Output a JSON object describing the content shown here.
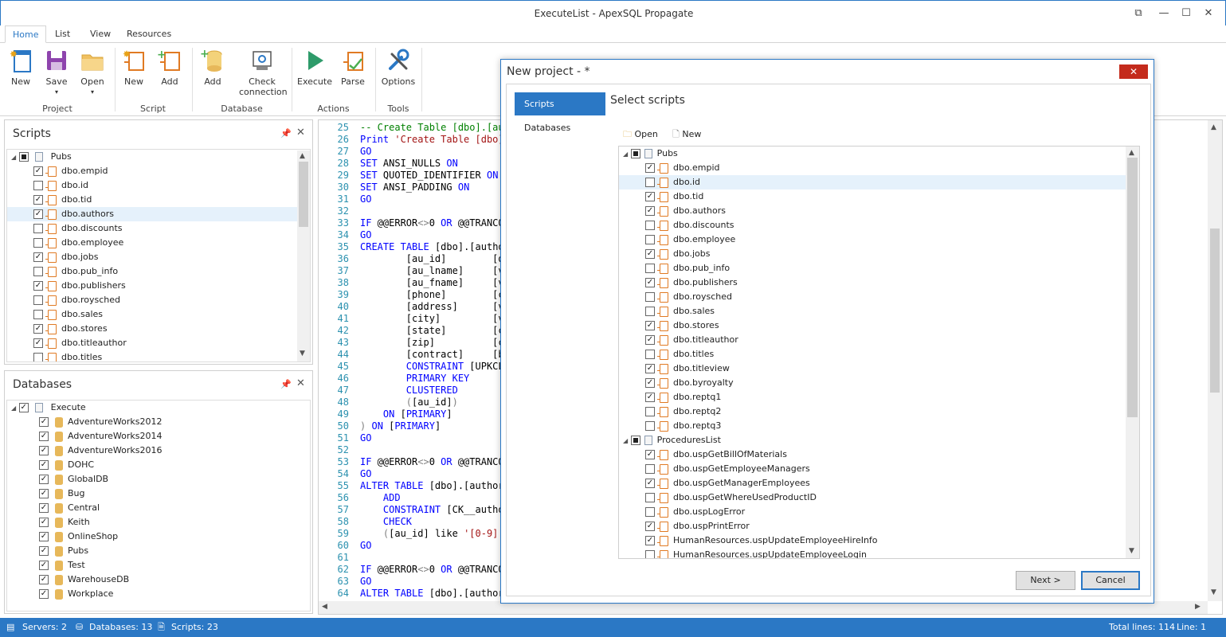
{
  "window": {
    "title": "ExecuteList - ApexSQL Propagate"
  },
  "ribbon_tabs": [
    "Home",
    "List",
    "View",
    "Resources"
  ],
  "ribbon": {
    "buttons": [
      {
        "label": "New",
        "icon": "new-project-icon"
      },
      {
        "label": "Save",
        "icon": "save-icon",
        "dropdown": true
      },
      {
        "label": "Open",
        "icon": "open-folder-icon",
        "dropdown": true
      },
      {
        "label": "New",
        "icon": "new-script-icon"
      },
      {
        "label": "Add",
        "icon": "add-script-icon"
      },
      {
        "label": "Add",
        "icon": "add-database-icon"
      },
      {
        "label": "Check connection",
        "icon": "check-connection-icon"
      },
      {
        "label": "Execute",
        "icon": "execute-icon"
      },
      {
        "label": "Parse",
        "icon": "parse-icon"
      },
      {
        "label": "Options",
        "icon": "options-icon"
      }
    ],
    "groups": [
      "Project",
      "Script",
      "Database",
      "Actions",
      "Tools"
    ]
  },
  "scripts_panel": {
    "title": "Scripts",
    "root": "Pubs",
    "items": [
      {
        "name": "dbo.empid",
        "checked": true
      },
      {
        "name": "dbo.id",
        "checked": false
      },
      {
        "name": "dbo.tid",
        "checked": true
      },
      {
        "name": "dbo.authors",
        "checked": true
      },
      {
        "name": "dbo.discounts",
        "checked": false
      },
      {
        "name": "dbo.employee",
        "checked": false
      },
      {
        "name": "dbo.jobs",
        "checked": true
      },
      {
        "name": "dbo.pub_info",
        "checked": false
      },
      {
        "name": "dbo.publishers",
        "checked": true
      },
      {
        "name": "dbo.roysched",
        "checked": false
      },
      {
        "name": "dbo.sales",
        "checked": false
      },
      {
        "name": "dbo.stores",
        "checked": true
      },
      {
        "name": "dbo.titleauthor",
        "checked": true
      },
      {
        "name": "dbo.titles",
        "checked": false
      }
    ]
  },
  "databases_panel": {
    "title": "Databases",
    "root": "Execute",
    "items": [
      "AdventureWorks2012",
      "AdventureWorks2014",
      "AdventureWorks2016",
      "DOHC",
      "GlobalDB",
      "Bug",
      "Central",
      "Keith",
      "OnlineShop",
      "Pubs",
      "Test",
      "WarehouseDB",
      "Workplace"
    ]
  },
  "editor": {
    "lines": [
      {
        "n": "25",
        "t": "-- Create Table [dbo].[au"
      },
      {
        "n": "26",
        "t": "Print 'Create Table [dbo]"
      },
      {
        "n": "27",
        "t": "GO"
      },
      {
        "n": "28",
        "t": "SET ANSI_NULLS ON"
      },
      {
        "n": "29",
        "t": "SET QUOTED_IDENTIFIER ON"
      },
      {
        "n": "30",
        "t": "SET ANSI_PADDING ON"
      },
      {
        "n": "31",
        "t": "GO"
      },
      {
        "n": "32",
        "t": ""
      },
      {
        "n": "33",
        "t": "IF @@ERROR<>0 OR @@TRANCO"
      },
      {
        "n": "34",
        "t": "GO"
      },
      {
        "n": "35",
        "t": "CREATE TABLE [dbo].[autho"
      },
      {
        "n": "36",
        "t": "        [au_id]        [d"
      },
      {
        "n": "37",
        "t": "        [au_lname]     [v"
      },
      {
        "n": "38",
        "t": "        [au_fname]     [v"
      },
      {
        "n": "39",
        "t": "        [phone]        [c"
      },
      {
        "n": "40",
        "t": "        [address]      [v"
      },
      {
        "n": "41",
        "t": "        [city]         [v"
      },
      {
        "n": "42",
        "t": "        [state]        [c"
      },
      {
        "n": "43",
        "t": "        [zip]          [c"
      },
      {
        "n": "44",
        "t": "        [contract]     [b"
      },
      {
        "n": "45",
        "t": "        CONSTRAINT [UPKCL_"
      },
      {
        "n": "46",
        "t": "        PRIMARY KEY"
      },
      {
        "n": "47",
        "t": "        CLUSTERED"
      },
      {
        "n": "48",
        "t": "        ([au_id])"
      },
      {
        "n": "49",
        "t": "    ON [PRIMARY]"
      },
      {
        "n": "50",
        "t": ") ON [PRIMARY]"
      },
      {
        "n": "51",
        "t": "GO"
      },
      {
        "n": "52",
        "t": ""
      },
      {
        "n": "53",
        "t": "IF @@ERROR<>0 OR @@TRANCO"
      },
      {
        "n": "54",
        "t": "GO"
      },
      {
        "n": "55",
        "t": "ALTER TABLE [dbo].[author"
      },
      {
        "n": "56",
        "t": "    ADD"
      },
      {
        "n": "57",
        "t": "    CONSTRAINT [CK__autho"
      },
      {
        "n": "58",
        "t": "    CHECK"
      },
      {
        "n": "59",
        "t": "    ([au_id] like '[0-9]["
      },
      {
        "n": "60",
        "t": "GO"
      },
      {
        "n": "61",
        "t": ""
      },
      {
        "n": "62",
        "t": "IF @@ERROR<>0 OR @@TRANCO"
      },
      {
        "n": "63",
        "t": "GO"
      },
      {
        "n": "64",
        "t": "ALTER TABLE [dbo].[author"
      }
    ]
  },
  "dialog": {
    "title": "New project - *",
    "nav": [
      "Scripts",
      "Databases"
    ],
    "heading": "Select scripts",
    "toolbar": {
      "open": "Open",
      "new": "New"
    },
    "groups": [
      {
        "name": "Pubs",
        "items": [
          {
            "name": "dbo.empid",
            "checked": true
          },
          {
            "name": "dbo.id",
            "checked": false
          },
          {
            "name": "dbo.tid",
            "checked": true
          },
          {
            "name": "dbo.authors",
            "checked": true
          },
          {
            "name": "dbo.discounts",
            "checked": false
          },
          {
            "name": "dbo.employee",
            "checked": false
          },
          {
            "name": "dbo.jobs",
            "checked": true
          },
          {
            "name": "dbo.pub_info",
            "checked": false
          },
          {
            "name": "dbo.publishers",
            "checked": true
          },
          {
            "name": "dbo.roysched",
            "checked": false
          },
          {
            "name": "dbo.sales",
            "checked": false
          },
          {
            "name": "dbo.stores",
            "checked": true
          },
          {
            "name": "dbo.titleauthor",
            "checked": true
          },
          {
            "name": "dbo.titles",
            "checked": false
          },
          {
            "name": "dbo.titleview",
            "checked": true
          },
          {
            "name": "dbo.byroyalty",
            "checked": true
          },
          {
            "name": "dbo.reptq1",
            "checked": true
          },
          {
            "name": "dbo.reptq2",
            "checked": false
          },
          {
            "name": "dbo.reptq3",
            "checked": false
          }
        ]
      },
      {
        "name": "ProceduresList",
        "items": [
          {
            "name": "dbo.uspGetBillOfMaterials",
            "checked": true
          },
          {
            "name": "dbo.uspGetEmployeeManagers",
            "checked": false
          },
          {
            "name": "dbo.uspGetManagerEmployees",
            "checked": true
          },
          {
            "name": "dbo.uspGetWhereUsedProductID",
            "checked": false
          },
          {
            "name": "dbo.uspLogError",
            "checked": false
          },
          {
            "name": "dbo.uspPrintError",
            "checked": true
          },
          {
            "name": "HumanResources.uspUpdateEmployeeHireInfo",
            "checked": true
          },
          {
            "name": "HumanResources.uspUpdateEmployeeLogin",
            "checked": false
          }
        ]
      }
    ],
    "buttons": {
      "next": "Next >",
      "cancel": "Cancel"
    }
  },
  "statusbar": {
    "servers": "Servers: 2",
    "databases": "Databases: 13",
    "scripts": "Scripts: 23",
    "total_lines": "Total lines: 114",
    "line": "Line: 1"
  },
  "colors": {
    "accent": "#2b78c5",
    "close_red": "#c42b1c",
    "script_icon": "#e07a23"
  }
}
